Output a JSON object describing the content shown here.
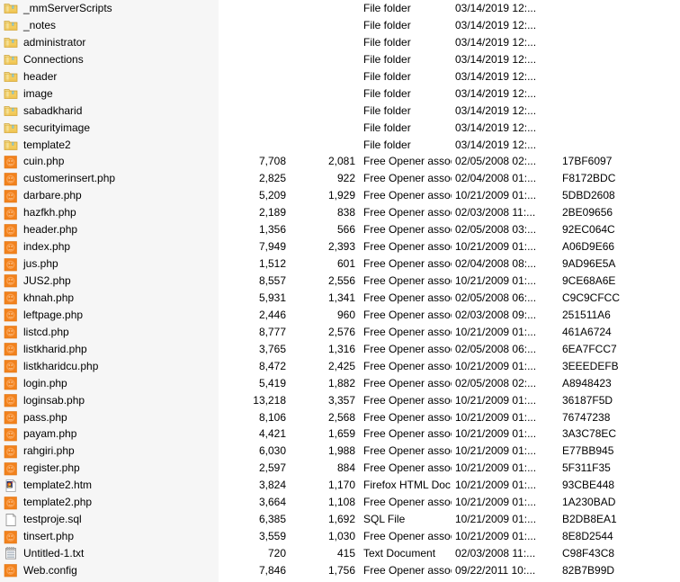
{
  "view": {
    "name": "file-list-details-view",
    "name_column_background": "#f6f6f6",
    "content_background": "#ffffff",
    "text_color": "#000000"
  },
  "icons": {
    "folder": "folder-icon",
    "php": "php-file-icon",
    "firefox_html": "firefox-html-document-icon",
    "blank_document": "blank-document-icon",
    "text_document": "text-document-icon"
  },
  "rows": [
    {
      "icon": "folder",
      "name": "_mmServerScripts",
      "size1": "",
      "size2": "",
      "type": "File folder",
      "date": "03/14/2019 12:...",
      "hash": ""
    },
    {
      "icon": "folder",
      "name": "_notes",
      "size1": "",
      "size2": "",
      "type": "File folder",
      "date": "03/14/2019 12:...",
      "hash": ""
    },
    {
      "icon": "folder",
      "name": "administrator",
      "size1": "",
      "size2": "",
      "type": "File folder",
      "date": "03/14/2019 12:...",
      "hash": ""
    },
    {
      "icon": "folder",
      "name": "Connections",
      "size1": "",
      "size2": "",
      "type": "File folder",
      "date": "03/14/2019 12:...",
      "hash": ""
    },
    {
      "icon": "folder",
      "name": "header",
      "size1": "",
      "size2": "",
      "type": "File folder",
      "date": "03/14/2019 12:...",
      "hash": ""
    },
    {
      "icon": "folder",
      "name": "image",
      "size1": "",
      "size2": "",
      "type": "File folder",
      "date": "03/14/2019 12:...",
      "hash": ""
    },
    {
      "icon": "folder",
      "name": "sabadkharid",
      "size1": "",
      "size2": "",
      "type": "File folder",
      "date": "03/14/2019 12:...",
      "hash": ""
    },
    {
      "icon": "folder",
      "name": "securityimage",
      "size1": "",
      "size2": "",
      "type": "File folder",
      "date": "03/14/2019 12:...",
      "hash": ""
    },
    {
      "icon": "folder",
      "name": "template2",
      "size1": "",
      "size2": "",
      "type": "File folder",
      "date": "03/14/2019 12:...",
      "hash": ""
    },
    {
      "icon": "php",
      "name": "cuin.php",
      "size1": "7,708",
      "size2": "2,081",
      "type": "Free Opener associ...",
      "date": "02/05/2008 02:...",
      "hash": "17BF6097"
    },
    {
      "icon": "php",
      "name": "customerinsert.php",
      "size1": "2,825",
      "size2": "922",
      "type": "Free Opener associ...",
      "date": "02/04/2008 01:...",
      "hash": "F8172BDC"
    },
    {
      "icon": "php",
      "name": "darbare.php",
      "size1": "5,209",
      "size2": "1,929",
      "type": "Free Opener associ...",
      "date": "10/21/2009 01:...",
      "hash": "5DBD2608"
    },
    {
      "icon": "php",
      "name": "hazfkh.php",
      "size1": "2,189",
      "size2": "838",
      "type": "Free Opener associ...",
      "date": "02/03/2008 11:...",
      "hash": "2BE09656"
    },
    {
      "icon": "php",
      "name": "header.php",
      "size1": "1,356",
      "size2": "566",
      "type": "Free Opener associ...",
      "date": "02/05/2008 03:...",
      "hash": "92EC064C"
    },
    {
      "icon": "php",
      "name": "index.php",
      "size1": "7,949",
      "size2": "2,393",
      "type": "Free Opener associ...",
      "date": "10/21/2009 01:...",
      "hash": "A06D9E66"
    },
    {
      "icon": "php",
      "name": "jus.php",
      "size1": "1,512",
      "size2": "601",
      "type": "Free Opener associ...",
      "date": "02/04/2008 08:...",
      "hash": "9AD96E5A"
    },
    {
      "icon": "php",
      "name": "JUS2.php",
      "size1": "8,557",
      "size2": "2,556",
      "type": "Free Opener associ...",
      "date": "10/21/2009 01:...",
      "hash": "9CE68A6E"
    },
    {
      "icon": "php",
      "name": "khnah.php",
      "size1": "5,931",
      "size2": "1,341",
      "type": "Free Opener associ...",
      "date": "02/05/2008 06:...",
      "hash": "C9C9CFCC"
    },
    {
      "icon": "php",
      "name": "leftpage.php",
      "size1": "2,446",
      "size2": "960",
      "type": "Free Opener associ...",
      "date": "02/03/2008 09:...",
      "hash": "251511A6"
    },
    {
      "icon": "php",
      "name": "listcd.php",
      "size1": "8,777",
      "size2": "2,576",
      "type": "Free Opener associ...",
      "date": "10/21/2009 01:...",
      "hash": "461A6724"
    },
    {
      "icon": "php",
      "name": "listkharid.php",
      "size1": "3,765",
      "size2": "1,316",
      "type": "Free Opener associ...",
      "date": "02/05/2008 06:...",
      "hash": "6EA7FCC7"
    },
    {
      "icon": "php",
      "name": "listkharidcu.php",
      "size1": "8,472",
      "size2": "2,425",
      "type": "Free Opener associ...",
      "date": "10/21/2009 01:...",
      "hash": "3EEEDEFB"
    },
    {
      "icon": "php",
      "name": "login.php",
      "size1": "5,419",
      "size2": "1,882",
      "type": "Free Opener associ...",
      "date": "02/05/2008 02:...",
      "hash": "A8948423"
    },
    {
      "icon": "php",
      "name": "loginsab.php",
      "size1": "13,218",
      "size2": "3,357",
      "type": "Free Opener associ...",
      "date": "10/21/2009 01:...",
      "hash": "36187F5D"
    },
    {
      "icon": "php",
      "name": "pass.php",
      "size1": "8,106",
      "size2": "2,568",
      "type": "Free Opener associ...",
      "date": "10/21/2009 01:...",
      "hash": "76747238"
    },
    {
      "icon": "php",
      "name": "payam.php",
      "size1": "4,421",
      "size2": "1,659",
      "type": "Free Opener associ...",
      "date": "10/21/2009 01:...",
      "hash": "3A3C78EC"
    },
    {
      "icon": "php",
      "name": "rahgiri.php",
      "size1": "6,030",
      "size2": "1,988",
      "type": "Free Opener associ...",
      "date": "10/21/2009 01:...",
      "hash": "E77BB945"
    },
    {
      "icon": "php",
      "name": "register.php",
      "size1": "2,597",
      "size2": "884",
      "type": "Free Opener associ...",
      "date": "10/21/2009 01:...",
      "hash": "5F311F35"
    },
    {
      "icon": "firefox_html",
      "name": "template2.htm",
      "size1": "3,824",
      "size2": "1,170",
      "type": "Firefox HTML Doc...",
      "date": "10/21/2009 01:...",
      "hash": "93CBE448"
    },
    {
      "icon": "php",
      "name": "template2.php",
      "size1": "3,664",
      "size2": "1,108",
      "type": "Free Opener associ...",
      "date": "10/21/2009 01:...",
      "hash": "1A230BAD"
    },
    {
      "icon": "blank_document",
      "name": "testproje.sql",
      "size1": "6,385",
      "size2": "1,692",
      "type": "SQL File",
      "date": "10/21/2009 01:...",
      "hash": "B2DB8EA1"
    },
    {
      "icon": "php",
      "name": "tinsert.php",
      "size1": "3,559",
      "size2": "1,030",
      "type": "Free Opener associ...",
      "date": "10/21/2009 01:...",
      "hash": "8E8D2544"
    },
    {
      "icon": "text_document",
      "name": "Untitled-1.txt",
      "size1": "720",
      "size2": "415",
      "type": "Text Document",
      "date": "02/03/2008 11:...",
      "hash": "C98F43C8"
    },
    {
      "icon": "php",
      "name": "Web.config",
      "size1": "7,846",
      "size2": "1,756",
      "type": "Free Opener associ...",
      "date": "09/22/2011 10:...",
      "hash": "82B7B99D"
    }
  ]
}
